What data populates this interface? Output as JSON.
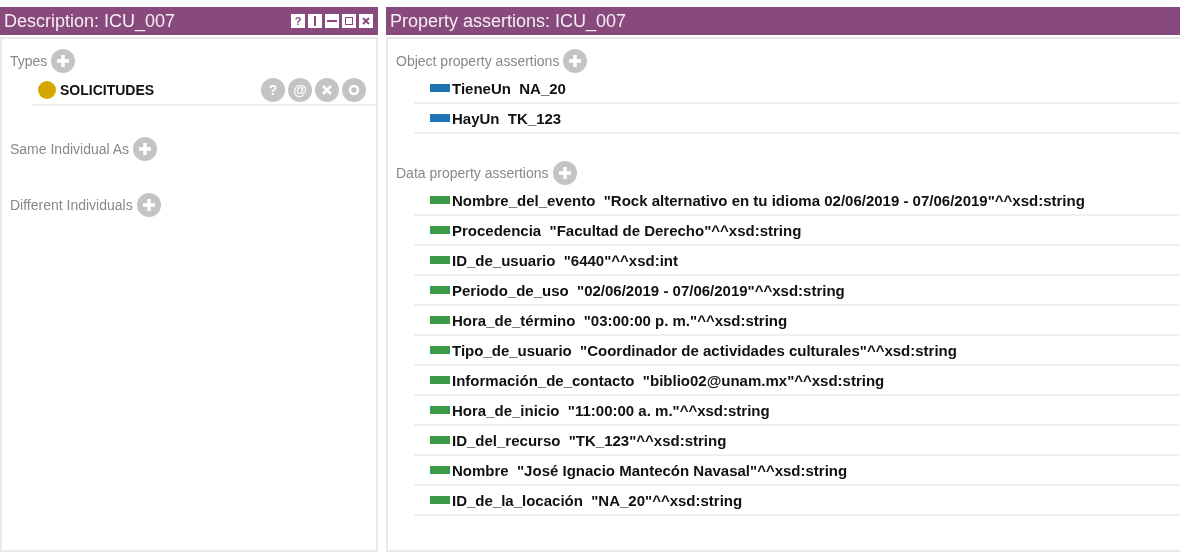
{
  "description": {
    "title": "Description: ICU_007",
    "help_label": "?",
    "sections": [
      {
        "label": "Types",
        "items": [
          {
            "name": "SOLICITUDES",
            "color": "#d4a800",
            "buttons": [
              "?",
              "@"
            ]
          }
        ]
      },
      {
        "label": "Same Individual As"
      },
      {
        "label": "Different Individuals"
      }
    ]
  },
  "assertions": {
    "title": "Property assertions: ICU_007",
    "sections": [
      {
        "label": "Object property assertions",
        "kind": "object",
        "rows": [
          "TieneUn  NA_20",
          "HayUn  TK_123"
        ]
      },
      {
        "label": "Data property assertions",
        "kind": "data",
        "rows": [
          "Nombre_del_evento  \"Rock alternativo en tu idioma 02/06/2019 - 07/06/2019\"^^xsd:string",
          "Procedencia  \"Facultad de Derecho\"^^xsd:string",
          "ID_de_usuario  \"6440\"^^xsd:int",
          "Periodo_de_uso  \"02/06/2019 - 07/06/2019\"^^xsd:string",
          "Hora_de_término  \"03:00:00 p. m.\"^^xsd:string",
          "Tipo_de_usuario  \"Coordinador de actividades culturales\"^^xsd:string",
          "Información_de_contacto  \"biblio02@unam.mx\"^^xsd:string",
          "Hora_de_inicio  \"11:00:00 a. m.\"^^xsd:string",
          "ID_del_recurso  \"TK_123\"^^xsd:string",
          "Nombre  \"José Ignacio Mantecón Navasal\"^^xsd:string",
          "ID_de_la_locación  \"NA_20\"^^xsd:string"
        ]
      }
    ]
  }
}
